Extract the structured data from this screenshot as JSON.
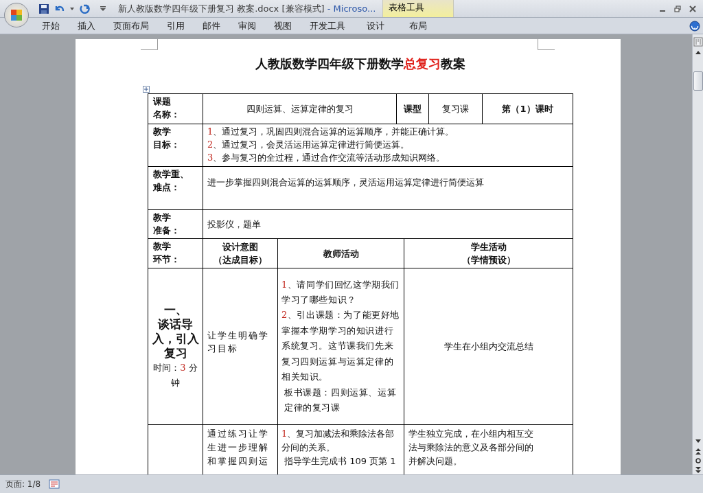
{
  "window": {
    "title": "新人教版数学四年级下册复习 教案.docx [兼容模式]",
    "app": " - Microso...",
    "context_group": "表格工具"
  },
  "ribbon_tabs": [
    {
      "label": "开始",
      "context": false
    },
    {
      "label": "插入",
      "context": false
    },
    {
      "label": "页面布局",
      "context": false
    },
    {
      "label": "引用",
      "context": false
    },
    {
      "label": "邮件",
      "context": false
    },
    {
      "label": "审阅",
      "context": false
    },
    {
      "label": "视图",
      "context": false
    },
    {
      "label": "开发工具",
      "context": false
    },
    {
      "label": "设计",
      "context": true
    },
    {
      "label": "布局",
      "context": true
    }
  ],
  "document": {
    "title": [
      {
        "text": "人教版数学四年级下册数学",
        "highlight": false
      },
      {
        "text": "总复习",
        "highlight": true
      },
      {
        "text": "教案",
        "highlight": false
      }
    ],
    "lesson": {
      "label": [
        "课题",
        "名称："
      ],
      "topic": "四则运算、运算定律的复习",
      "type_label": "课型",
      "type": "复习课",
      "period": "第（1）课时"
    },
    "objectives": {
      "label": [
        "教学",
        "目标："
      ],
      "items": [
        {
          "num": "1",
          "text": "、通过复习，巩固四则混合运算的运算顺序，并能正确计算。"
        },
        {
          "num": "2",
          "text": "、通过复习，会灵活运用运算定律进行简便运算。"
        },
        {
          "num": "3",
          "text": "、参与复习的全过程，通过合作交流等活动形成知识网络。"
        }
      ]
    },
    "key_points": {
      "label": [
        "教学重、",
        "难点："
      ],
      "text": "进一步掌握四则混合运算的运算顺序，灵活运用运算定律进行简便运算"
    },
    "preparation": {
      "label": [
        "教学",
        "准备："
      ],
      "text": "投影仪，题单"
    },
    "process_header": {
      "label": [
        "教学",
        "环节："
      ],
      "columns": [
        [
          "设计意图",
          "（达成目标）"
        ],
        [
          "教师活动"
        ],
        [
          "学生活动",
          "（学情预设）"
        ]
      ]
    },
    "stages": [
      {
        "title": [
          "一、",
          "谈话导",
          "入，引入",
          "复习"
        ],
        "time": [
          "时间：",
          "3",
          " 分钟"
        ],
        "intent": "让学生明确学习目标",
        "teacher": [
          {
            "num": "1",
            "text": "、请同学们回忆这学期我们学习了哪些知识？"
          },
          {
            "num": "2",
            "text": "、引出课题：为了能更好地掌握本学期学习的知识进行系统复习。这节课我们先来复习四则运算与运算定律的相关知识。"
          },
          {
            "text": "板书课题：四则运算、运算定律的复习课"
          }
        ],
        "student": [
          "学生在小组内交流总结"
        ]
      },
      {
        "intent": "通过练习让学生进一步理解和掌握四则运",
        "teacher": [
          {
            "num": "1",
            "text": "、复习加减法和乘除法各部分间的关系。"
          },
          {
            "text": "指导学生完成书 109 页第 1"
          }
        ],
        "student": [
          "学生独立完成，在小组内相互交",
          "法与乘除法的意义及各部分间的",
          "并解决问题。"
        ]
      }
    ]
  },
  "status_bar": {
    "page": "页面: 1/8"
  }
}
